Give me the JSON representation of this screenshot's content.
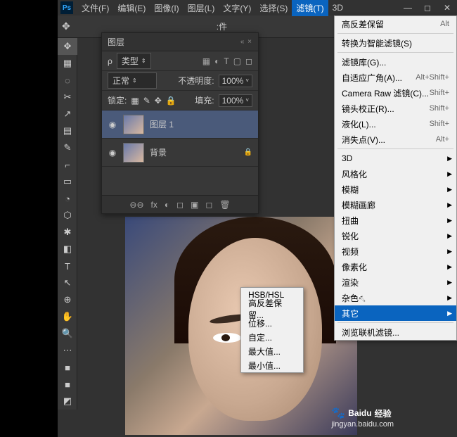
{
  "menubar": {
    "items": [
      "文件(F)",
      "编辑(E)",
      "图像(I)",
      "图层(L)",
      "文字(Y)",
      "选择(S)",
      "滤镜(T)",
      "3D"
    ],
    "active_index": 6
  },
  "options_bar": {
    "plugin_label": ":件"
  },
  "tools": [
    "✥",
    "▦",
    "◌",
    "✂",
    "↗",
    "▤",
    "✎",
    "⌐",
    "▭",
    "◔",
    "⬡",
    "✱",
    "◧",
    "◢",
    "T",
    "↖",
    "⊕",
    "✋",
    "🔍",
    "⋯",
    "■",
    "■",
    "◩"
  ],
  "layers_panel": {
    "title": "图层",
    "pin": "«  ×",
    "filter_type": "类型",
    "filter_icons": [
      "▦",
      "◐",
      "T",
      "▢",
      "◻"
    ],
    "blend_mode": "正常",
    "opacity_label": "不透明度:",
    "opacity_value": "100%",
    "lock_label": "锁定:",
    "lock_icons": [
      "▦",
      "✎",
      "✥",
      "🔒"
    ],
    "fill_label": "填充:",
    "fill_value": "100%",
    "layers": [
      {
        "name": "图层 1",
        "selected": true,
        "locked": false
      },
      {
        "name": "背景",
        "selected": false,
        "locked": true
      }
    ],
    "footer_icons": [
      "⊖⊖",
      "fx",
      "◐",
      "◻",
      "▣",
      "◻",
      "🗑"
    ]
  },
  "filter_menu": {
    "items": [
      {
        "label": "高反差保留",
        "shortcut": "Alt",
        "sep_after": false
      },
      {
        "label": "转换为智能滤镜(S)",
        "sep_before": true,
        "sep_after": true
      },
      {
        "label": "滤镜库(G)..."
      },
      {
        "label": "自适应广角(A)...",
        "shortcut": "Alt+Shift+"
      },
      {
        "label": "Camera Raw 滤镜(C)...",
        "shortcut": "Shift+"
      },
      {
        "label": "镜头校正(R)...",
        "shortcut": "Shift+"
      },
      {
        "label": "液化(L)...",
        "shortcut": "Shift+"
      },
      {
        "label": "消失点(V)...",
        "shortcut": "Alt+",
        "sep_after": true
      },
      {
        "label": "3D",
        "arrow": true
      },
      {
        "label": "风格化",
        "arrow": true
      },
      {
        "label": "模糊",
        "arrow": true
      },
      {
        "label": "模糊画廊",
        "arrow": true
      },
      {
        "label": "扭曲",
        "arrow": true
      },
      {
        "label": "锐化",
        "arrow": true
      },
      {
        "label": "视频",
        "arrow": true
      },
      {
        "label": "像素化",
        "arrow": true
      },
      {
        "label": "渲染",
        "arrow": true
      },
      {
        "label": "杂色",
        "arrow": true
      },
      {
        "label": "其它",
        "arrow": true,
        "selected": true,
        "sep_after": true
      },
      {
        "label": "浏览联机滤镜..."
      }
    ]
  },
  "sub_menu": {
    "items": [
      "HSB/HSL",
      "高反差保留...",
      "位移...",
      "自定...",
      "最大值...",
      "最小值..."
    ]
  },
  "watermark": {
    "brand": "Baidu",
    "suffix": "经验",
    "url": "jingyan.baidu.com"
  }
}
